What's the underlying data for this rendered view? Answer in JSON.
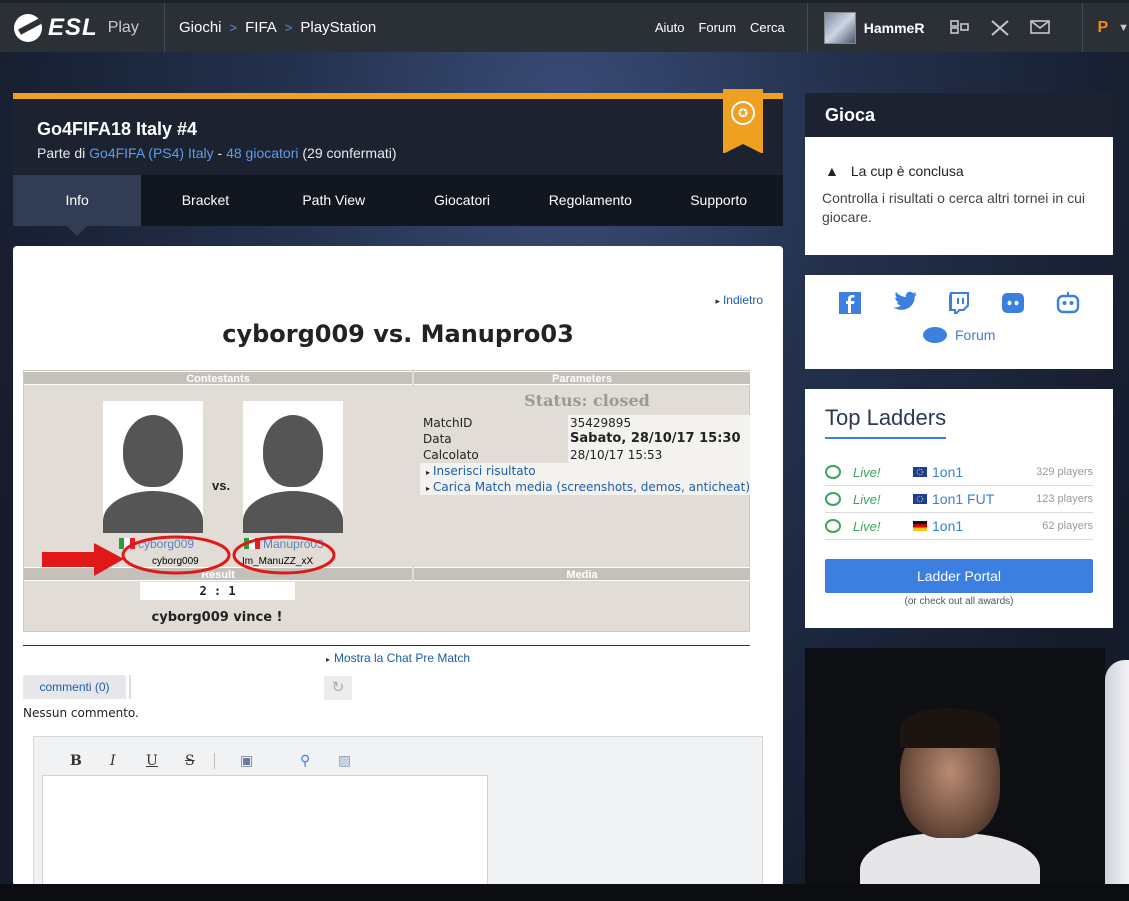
{
  "topnav": {
    "logo_text": "ESL",
    "logo_sub": "Play",
    "breadcrumbs": [
      "Giochi",
      "FIFA",
      "PlayStation"
    ],
    "links": [
      "Aiuto",
      "Forum",
      "Cerca"
    ],
    "username": "HammeR",
    "premium_label": "P",
    "icons": [
      "teams-icon",
      "swords-icon",
      "mail-icon",
      "chevron-down-icon"
    ]
  },
  "cup": {
    "title": "Go4FIFA18 Italy #4",
    "sub_prefix": "Parte di ",
    "series_link": "Go4FIFA (PS4) Italy",
    "sep": " - ",
    "players_link": "48 giocatori",
    "confirmed": " (29 confermati)"
  },
  "tabs": [
    "Info",
    "Bracket",
    "Path View",
    "Giocatori",
    "Regolamento",
    "Supporto"
  ],
  "match": {
    "back_link": "Indietro",
    "title": "cyborg009 vs. Manupro03",
    "contestants_header": "Contestants",
    "parameters_header": "Parameters",
    "status": "Status: closed",
    "vs": "vs.",
    "player1": {
      "name": "cyborg009",
      "account": "cyborg009"
    },
    "player2": {
      "name": "Manupro03",
      "account": "Im_ManuZZ_xX"
    },
    "params": [
      {
        "key": "MatchID",
        "value": "35429895"
      },
      {
        "key": "Data",
        "value": "Sabato, 28/10/17 15:30"
      },
      {
        "key": "Calcolato",
        "value": "28/10/17 15:53"
      }
    ],
    "param_links": [
      "Inserisci risultato",
      "Carica Match media (screenshots, demos, anticheat)"
    ],
    "result_header": "Result",
    "media_header": "Media",
    "score": "2 : 1",
    "winner": "cyborg009 vince !"
  },
  "comments": {
    "chat_link": "Mostra la Chat Pre Match",
    "tab_label": "commenti (0)",
    "empty": "Nessun commento.",
    "toolbar": [
      "B",
      "I",
      "U",
      "S"
    ]
  },
  "sidebar": {
    "gioca_title": "Gioca",
    "gioca_warn": "La cup è conclusa",
    "gioca_text": "Controlla i risultati o cerca altri tornei in cui giocare.",
    "social": [
      "f",
      "t",
      "tw",
      "d",
      "bot"
    ],
    "forum": "Forum",
    "top_ladders_title": "Top Ladders",
    "ladders": [
      {
        "status": "Live!",
        "name": "1on1",
        "players": "329 players",
        "region": "eu"
      },
      {
        "status": "Live!",
        "name": "1on1 FUT",
        "players": "123 players",
        "region": "eu"
      },
      {
        "status": "Live!",
        "name": "1on1",
        "players": "62 players",
        "region": "de"
      }
    ],
    "ladder_button": "Ladder Portal",
    "ladder_sub": "(or check out all awards)"
  },
  "colors": {
    "accent": "#3b7fe0",
    "orange": "#f0a020",
    "annotation": "#e01818",
    "live": "#3aa55a"
  }
}
